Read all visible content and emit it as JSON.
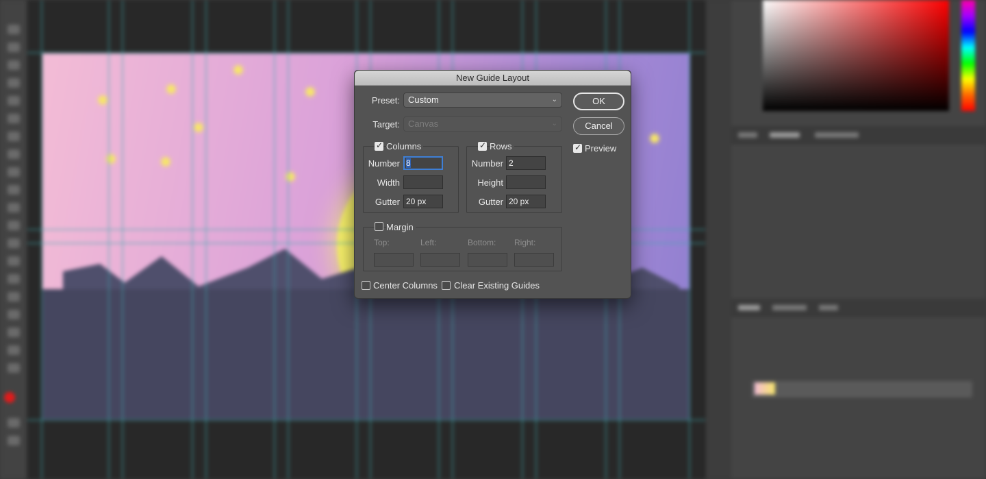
{
  "dialog": {
    "title": "New Guide Layout",
    "preset_label": "Preset:",
    "preset_value": "Custom",
    "target_label": "Target:",
    "target_value": "Canvas",
    "ok_label": "OK",
    "cancel_label": "Cancel",
    "preview_label": "Preview",
    "preview_checked": true,
    "columns": {
      "label": "Columns",
      "checked": true,
      "number_label": "Number",
      "number_value": "8",
      "width_label": "Width",
      "width_value": "",
      "gutter_label": "Gutter",
      "gutter_value": "20 px"
    },
    "rows": {
      "label": "Rows",
      "checked": true,
      "number_label": "Number",
      "number_value": "2",
      "height_label": "Height",
      "height_value": "",
      "gutter_label": "Gutter",
      "gutter_value": "20 px"
    },
    "margin": {
      "label": "Margin",
      "checked": false,
      "top_label": "Top:",
      "left_label": "Left:",
      "bottom_label": "Bottom:",
      "right_label": "Right:"
    },
    "center_columns_label": "Center Columns",
    "center_columns_checked": false,
    "clear_guides_label": "Clear Existing Guides",
    "clear_guides_checked": false
  },
  "colors": {
    "guide": "#3caaaf",
    "focus_ring": "#3e7fd6",
    "foreground_color": "#e01b1b"
  }
}
